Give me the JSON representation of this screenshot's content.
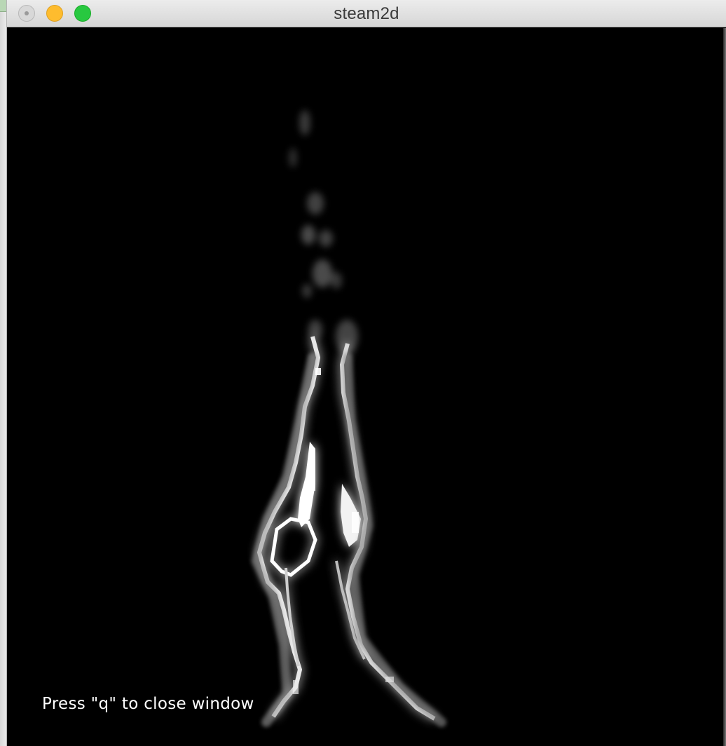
{
  "window": {
    "title": "steam2d",
    "buttons": {
      "close": "close-button",
      "minimize": "minimize-button",
      "zoom": "zoom-button"
    }
  },
  "canvas": {
    "overlay_text": "Press \"q\" to close window",
    "background_color": "#000000",
    "plume_color": "#ffffff"
  }
}
